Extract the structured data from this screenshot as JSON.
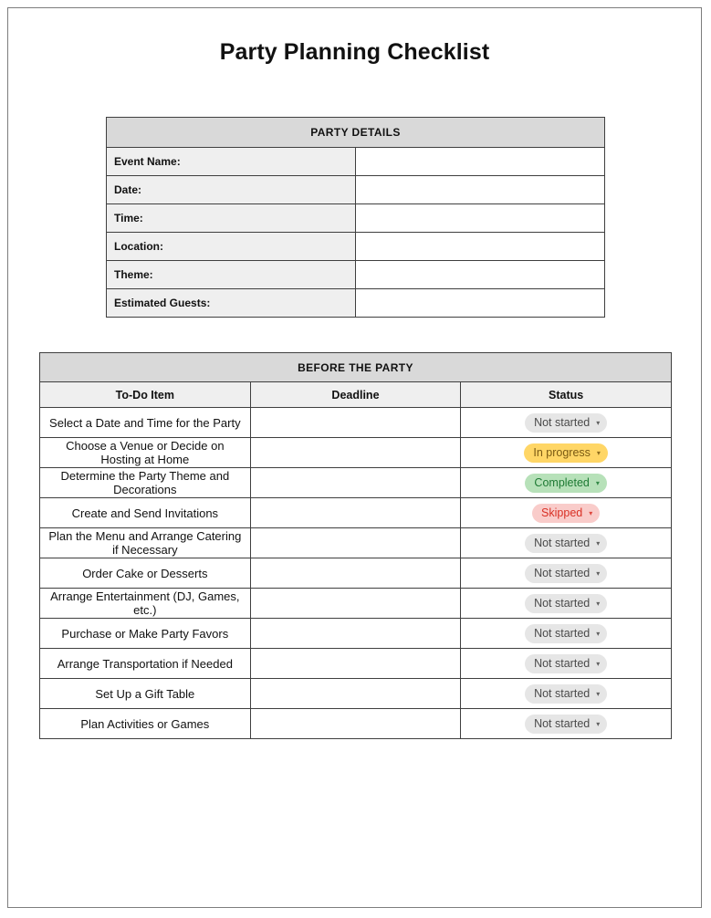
{
  "document": {
    "title": "Party Planning Checklist"
  },
  "party_details": {
    "header": "PARTY DETAILS",
    "rows": [
      {
        "label": "Event Name:",
        "value": ""
      },
      {
        "label": "Date:",
        "value": ""
      },
      {
        "label": "Time:",
        "value": ""
      },
      {
        "label": "Location:",
        "value": ""
      },
      {
        "label": "Theme:",
        "value": ""
      },
      {
        "label": "Estimated Guests:",
        "value": ""
      }
    ]
  },
  "checklist": {
    "section_header": "BEFORE THE PARTY",
    "columns": {
      "todo": "To-Do Item",
      "deadline": "Deadline",
      "status": "Status"
    },
    "status_options": [
      "Not started",
      "In progress",
      "Completed",
      "Skipped"
    ],
    "caret_icon": "▾",
    "rows": [
      {
        "todo": "Select a Date and Time for the Party",
        "deadline": "",
        "status": "Not started",
        "status_key": "notstarted"
      },
      {
        "todo": "Choose a Venue or Decide on Hosting at Home",
        "deadline": "",
        "status": "In progress",
        "status_key": "inprogress"
      },
      {
        "todo": "Determine the Party Theme and Decorations",
        "deadline": "",
        "status": "Completed",
        "status_key": "completed"
      },
      {
        "todo": "Create and Send Invitations",
        "deadline": "",
        "status": "Skipped",
        "status_key": "skipped"
      },
      {
        "todo": "Plan the Menu and Arrange Catering if Necessary",
        "deadline": "",
        "status": "Not started",
        "status_key": "notstarted"
      },
      {
        "todo": "Order Cake or Desserts",
        "deadline": "",
        "status": "Not started",
        "status_key": "notstarted"
      },
      {
        "todo": "Arrange Entertainment (DJ, Games, etc.)",
        "deadline": "",
        "status": "Not started",
        "status_key": "notstarted"
      },
      {
        "todo": "Purchase or Make Party Favors",
        "deadline": "",
        "status": "Not started",
        "status_key": "notstarted"
      },
      {
        "todo": "Arrange Transportation if Needed",
        "deadline": "",
        "status": "Not started",
        "status_key": "notstarted"
      },
      {
        "todo": "Set Up a Gift Table",
        "deadline": "",
        "status": "Not started",
        "status_key": "notstarted"
      },
      {
        "todo": "Plan Activities or Games",
        "deadline": "",
        "status": "Not started",
        "status_key": "notstarted"
      }
    ]
  },
  "colors": {
    "section_header_bg": "#D9D9D9",
    "column_header_bg": "#EFEFEF",
    "label_cell_bg": "#EFEFEF",
    "border": "#3F3F3F",
    "page_border": "#7D7D7D",
    "status_notstarted_bg": "#E6E6E6",
    "status_notstarted_fg": "#4A4A4A",
    "status_inprogress_bg": "#FFD666",
    "status_inprogress_fg": "#7A5A13",
    "status_completed_bg": "#B7E1B9",
    "status_completed_fg": "#1E7A34",
    "status_skipped_bg": "#F9CCCA",
    "status_skipped_fg": "#D93025"
  }
}
